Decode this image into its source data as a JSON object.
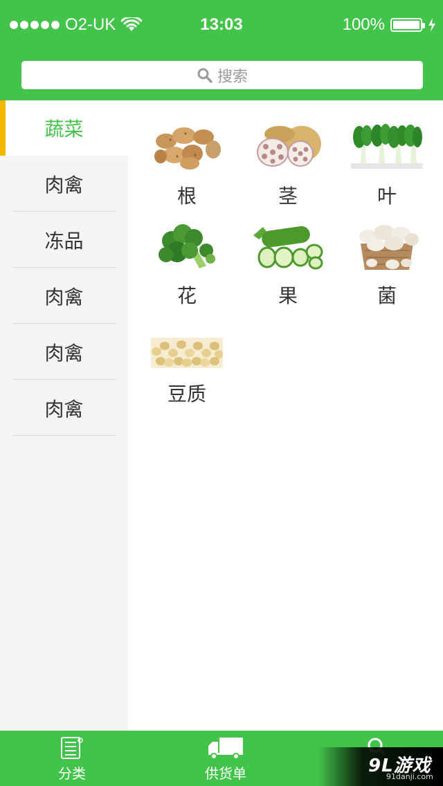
{
  "status_bar": {
    "carrier": "O2-UK",
    "time": "13:03",
    "battery": "100%"
  },
  "search": {
    "placeholder": "搜索",
    "icon": "search-icon"
  },
  "sidebar": {
    "items": [
      {
        "label": "蔬菜",
        "active": true
      },
      {
        "label": "肉禽"
      },
      {
        "label": "冻品"
      },
      {
        "label": "肉禽"
      },
      {
        "label": "肉禽"
      },
      {
        "label": "肉禽"
      }
    ]
  },
  "categories": [
    {
      "label": "根",
      "image": "potatoes"
    },
    {
      "label": "茎",
      "image": "lotus-root"
    },
    {
      "label": "叶",
      "image": "bok-choy"
    },
    {
      "label": "花",
      "image": "broccoli"
    },
    {
      "label": "果",
      "image": "cucumber"
    },
    {
      "label": "菌",
      "image": "mushrooms"
    },
    {
      "label": "豆质",
      "image": "soybeans"
    }
  ],
  "tab_bar": {
    "tabs": [
      {
        "label": "分类",
        "icon": "category-list-icon"
      },
      {
        "label": "供货单",
        "icon": "delivery-truck-icon"
      },
      {
        "label": "",
        "icon": "search-icon"
      }
    ]
  },
  "watermark": {
    "logo": "9L游戏",
    "url": "91danji.com"
  },
  "colors": {
    "brand_green": "#42c34a",
    "active_indicator": "#f5b800",
    "sidebar_bg": "#f4f4f4"
  }
}
